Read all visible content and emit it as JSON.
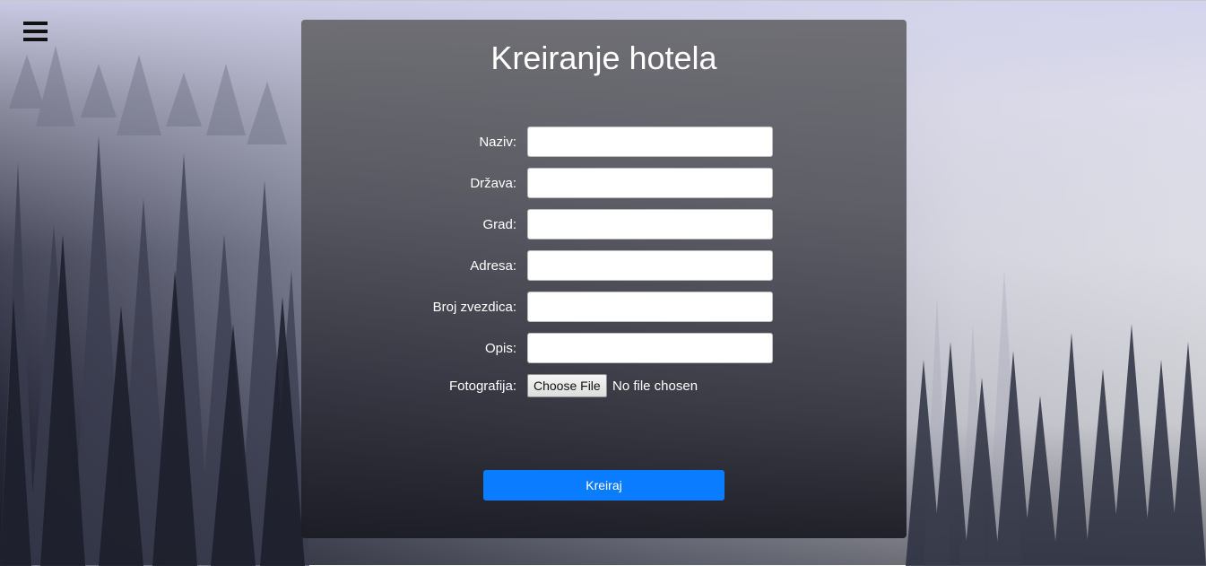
{
  "page": {
    "title": "Kreiranje hotela",
    "menu_icon": "hamburger-menu-icon"
  },
  "form": {
    "fields": [
      {
        "label": "Naziv:",
        "value": "",
        "placeholder": ""
      },
      {
        "label": "Država:",
        "value": "",
        "placeholder": ""
      },
      {
        "label": "Grad:",
        "value": "",
        "placeholder": ""
      },
      {
        "label": "Adresa:",
        "value": "",
        "placeholder": ""
      },
      {
        "label": "Broj zvezdica:",
        "value": "",
        "placeholder": ""
      },
      {
        "label": "Opis:",
        "value": "",
        "placeholder": ""
      }
    ],
    "photo": {
      "label": "Fotografija:",
      "button_label": "Choose File",
      "status": "No file chosen"
    },
    "submit_label": "Kreiraj"
  },
  "colors": {
    "submit_button": "#0a7cff",
    "panel": "#5a5a62",
    "text": "#ffffff"
  }
}
